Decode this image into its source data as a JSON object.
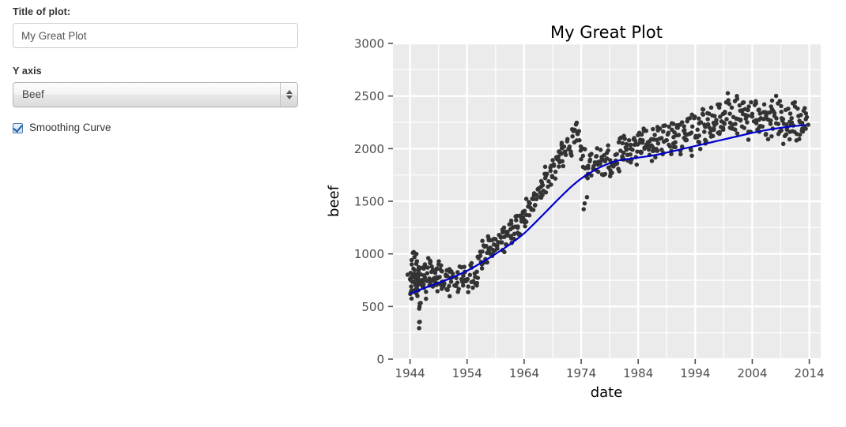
{
  "controls": {
    "title_label": "Title of plot:",
    "title_value": "My Great Plot",
    "title_placeholder": "Title of plot",
    "yaxis_label": "Y axis",
    "yaxis_value": "Beef",
    "yaxis_options": [
      "Beef"
    ],
    "smoothing_label": "Smoothing Curve",
    "smoothing_checked": true
  },
  "colors": {
    "panel_background": "#EBEBEB",
    "gridline_major": "#FFFFFF",
    "gridline_minor": "#FFFFFF",
    "point": "#333333",
    "smooth_line": "#0000CD",
    "tick_text": "#4D4D4D",
    "page_background": "#FFFFFF",
    "input_border": "#CCCCCC",
    "checkbox_accent": "#1B5FA8"
  },
  "chart_data": {
    "type": "scatter",
    "title": "My Great Plot",
    "xlabel": "date",
    "ylabel": "beef",
    "xlim": [
      1941,
      2016
    ],
    "ylim": [
      0,
      3000
    ],
    "xticks": [
      1944,
      1954,
      1964,
      1974,
      1984,
      1994,
      2004,
      2014
    ],
    "yticks": [
      0,
      500,
      1000,
      1500,
      2000,
      2500,
      3000
    ],
    "xtick_labels": [
      "1944",
      "1954",
      "1964",
      "1974",
      "1984",
      "1994",
      "2004",
      "2014"
    ],
    "ytick_labels": [
      "0",
      "500",
      "1000",
      "1500",
      "2000",
      "2500",
      "3000"
    ],
    "grid": true,
    "minor_grid": true,
    "legend": "none",
    "point_color": "#333333",
    "point_size": 5.5,
    "series": [
      {
        "name": "beef",
        "type": "scatter",
        "x": [
          1944.0,
          1944.1,
          1944.2,
          1944.3,
          1944.4,
          1944.5,
          1944.6,
          1944.7,
          1944.8,
          1944.9,
          1945.0,
          1945.1,
          1945.2,
          1945.3,
          1945.4,
          1945.5,
          1945.6,
          1945.7,
          1945.8,
          1945.9,
          1946.0,
          1946.2,
          1946.4,
          1946.6,
          1946.8,
          1947.0,
          1947.2,
          1947.4,
          1947.6,
          1947.8,
          1948.0,
          1948.2,
          1948.4,
          1948.6,
          1948.8,
          1949.0,
          1949.2,
          1949.4,
          1949.6,
          1949.8,
          1950.0,
          1950.3,
          1950.6,
          1950.9,
          1951.2,
          1951.5,
          1951.8,
          1952.1,
          1952.4,
          1952.7,
          1953.0,
          1953.3,
          1953.6,
          1953.9,
          1954.2,
          1954.5,
          1954.8,
          1955.1,
          1955.4,
          1955.7,
          1956.0,
          1956.3,
          1956.6,
          1956.9,
          1957.2,
          1957.5,
          1957.8,
          1958.1,
          1958.4,
          1958.7,
          1959.0,
          1959.3,
          1959.6,
          1959.9,
          1960.2,
          1960.5,
          1960.8,
          1961.1,
          1961.4,
          1961.7,
          1962.0,
          1962.3,
          1962.6,
          1962.9,
          1963.2,
          1963.5,
          1963.8,
          1964.1,
          1964.4,
          1964.7,
          1965.0,
          1965.3,
          1965.6,
          1965.9,
          1966.2,
          1966.5,
          1966.8,
          1967.1,
          1967.4,
          1967.7,
          1968.0,
          1968.3,
          1968.6,
          1968.9,
          1969.2,
          1969.5,
          1969.8,
          1970.1,
          1970.4,
          1970.7,
          1971.0,
          1971.3,
          1971.6,
          1971.9,
          1972.2,
          1972.5,
          1972.8,
          1973.1,
          1973.4,
          1973.7,
          1974.0,
          1974.3,
          1974.6,
          1974.9,
          1975.2,
          1975.5,
          1975.8,
          1976.1,
          1976.4,
          1976.7,
          1977.0,
          1977.3,
          1977.6,
          1977.9,
          1978.2,
          1978.5,
          1978.8,
          1979.1,
          1979.4,
          1979.7,
          1980.0,
          1980.3,
          1980.6,
          1980.9,
          1981.2,
          1981.5,
          1981.8,
          1982.1,
          1982.4,
          1982.7,
          1983.0,
          1983.3,
          1983.6,
          1983.9,
          1984.2,
          1984.5,
          1984.8,
          1985.1,
          1985.4,
          1985.7,
          1986.0,
          1986.3,
          1986.6,
          1986.9,
          1987.2,
          1987.5,
          1987.8,
          1988.1,
          1988.4,
          1988.7,
          1989.0,
          1989.3,
          1989.6,
          1989.9,
          1990.2,
          1990.5,
          1990.8,
          1991.1,
          1991.4,
          1991.7,
          1992.0,
          1992.3,
          1992.6,
          1992.9,
          1993.2,
          1993.5,
          1993.8,
          1994.1,
          1994.4,
          1994.7,
          1995.0,
          1995.3,
          1995.6,
          1995.9,
          1996.2,
          1996.5,
          1996.8,
          1997.1,
          1997.4,
          1997.7,
          1998.0,
          1998.3,
          1998.6,
          1998.9,
          1999.2,
          1999.5,
          1999.8,
          2000.1,
          2000.4,
          2000.7,
          2001.0,
          2001.3,
          2001.6,
          2001.9,
          2002.2,
          2002.5,
          2002.8,
          2003.1,
          2003.4,
          2003.7,
          2004.0,
          2004.3,
          2004.6,
          2004.9,
          2005.2,
          2005.5,
          2005.8,
          2006.1,
          2006.4,
          2006.7,
          2007.0,
          2007.3,
          2007.6,
          2007.9,
          2008.2,
          2008.5,
          2008.8,
          2009.1,
          2009.4,
          2009.7,
          2010.0,
          2010.3,
          2010.6,
          2010.9,
          2011.2,
          2011.5,
          2011.8,
          2012.1,
          2012.4,
          2012.7,
          2013.0,
          2013.2,
          2013.4
        ],
        "y": [
          760,
          820,
          690,
          900,
          735,
          1010,
          640,
          780,
          845,
          715,
          700,
          660,
          930,
          600,
          770,
          840,
          480,
          355,
          720,
          805,
          745,
          690,
          860,
          775,
          640,
          815,
          960,
          700,
          735,
          880,
          690,
          760,
          820,
          705,
          645,
          900,
          780,
          715,
          835,
          690,
          720,
          790,
          660,
          855,
          735,
          810,
          700,
          770,
          640,
          880,
          760,
          700,
          830,
          745,
          690,
          800,
          870,
          740,
          780,
          700,
          960,
          1020,
          900,
          1080,
          950,
          1010,
          1130,
          1060,
          980,
          1090,
          1140,
          1050,
          1180,
          1110,
          1230,
          1160,
          1090,
          1210,
          1280,
          1170,
          1250,
          1190,
          1320,
          1260,
          1180,
          1340,
          1400,
          1300,
          1370,
          1450,
          1480,
          1420,
          1520,
          1460,
          1560,
          1620,
          1540,
          1680,
          1600,
          1720,
          1760,
          1690,
          1820,
          1740,
          1850,
          1780,
          1900,
          1830,
          1960,
          1880,
          2020,
          1940,
          2090,
          2000,
          1950,
          2180,
          2060,
          2230,
          2140,
          2080,
          1900,
          2000,
          1480,
          1820,
          1760,
          1880,
          1950,
          1810,
          1870,
          1930,
          1780,
          1860,
          1920,
          1750,
          1880,
          1960,
          1820,
          1890,
          1770,
          1850,
          1940,
          1860,
          2060,
          1980,
          1900,
          2120,
          2010,
          1940,
          2080,
          1870,
          1990,
          2100,
          1920,
          2040,
          2150,
          1960,
          2080,
          2000,
          2170,
          2060,
          1940,
          2090,
          2010,
          2130,
          1980,
          2050,
          2190,
          2100,
          1960,
          2220,
          2080,
          2150,
          2020,
          2240,
          2110,
          2060,
          2200,
          2130,
          1980,
          2250,
          2170,
          2090,
          2260,
          2140,
          2000,
          2210,
          2290,
          2120,
          2180,
          2060,
          2250,
          2330,
          2160,
          2070,
          2280,
          2200,
          2390,
          2120,
          2310,
          2240,
          2150,
          2420,
          2260,
          2180,
          2350,
          2280,
          2460,
          2200,
          2390,
          2300,
          2180,
          2500,
          2280,
          2360,
          2210,
          2440,
          2320,
          2250,
          2400,
          2160,
          2330,
          2260,
          2450,
          2180,
          2370,
          2290,
          2210,
          2420,
          2140,
          2340,
          2270,
          2400,
          2190,
          2310,
          2240,
          2430,
          2160,
          2350,
          2280,
          2120,
          2230,
          2380,
          2160,
          2290,
          2220,
          2400,
          2140,
          2310,
          2250,
          2170,
          2360,
          2200,
          2280
        ]
      },
      {
        "name": "smoothing curve",
        "type": "line",
        "color": "#0000CD",
        "x": [
          1944,
          1946,
          1948,
          1950,
          1952,
          1954,
          1956,
          1958,
          1960,
          1962,
          1964,
          1966,
          1968,
          1970,
          1972,
          1974,
          1976,
          1978,
          1980,
          1982,
          1984,
          1986,
          1988,
          1990,
          1992,
          1994,
          1996,
          1998,
          2000,
          2002,
          2004,
          2006,
          2008,
          2010,
          2012,
          2013.5
        ],
        "y": [
          620,
          665,
          705,
          745,
          790,
          840,
          900,
          965,
          1035,
          1110,
          1195,
          1300,
          1410,
          1520,
          1625,
          1715,
          1785,
          1840,
          1880,
          1900,
          1915,
          1930,
          1950,
          1975,
          2000,
          2025,
          2050,
          2075,
          2100,
          2125,
          2150,
          2172,
          2190,
          2205,
          2218,
          2225
        ]
      }
    ]
  }
}
